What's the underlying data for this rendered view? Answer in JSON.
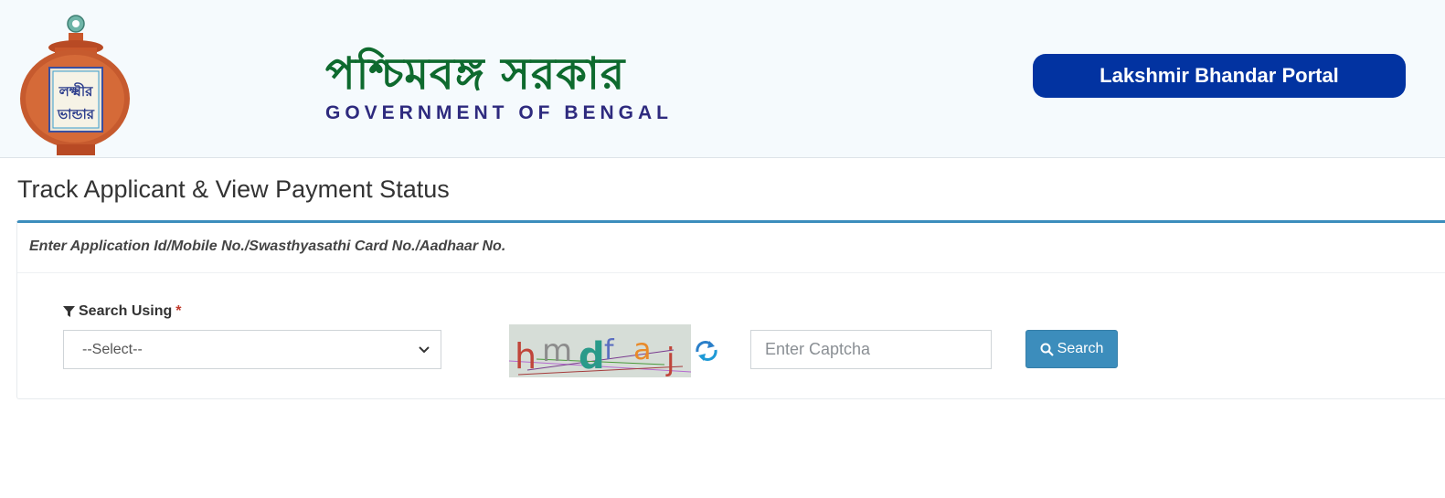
{
  "header": {
    "bengali_title": "পশ্চিমবঙ্গ সরকার",
    "english_title": "GOVERNMENT OF BENGAL",
    "portal_label": "Lakshmir Bhandar Portal",
    "logo_text_line1": "লক্ষ্মীর",
    "logo_text_line2": "ভান্ডার"
  },
  "page": {
    "heading": "Track Applicant & View Payment Status"
  },
  "form": {
    "instruction": "Enter Application Id/Mobile No./Swasthyasathi Card No./Aadhaar No.",
    "search_label": "Search Using",
    "required_mark": "*",
    "select_value": "--Select--",
    "captcha_text": "hmdfaj",
    "captcha_placeholder": "Enter Captcha",
    "search_button": "Search"
  },
  "colors": {
    "brand_green": "#0e6a2e",
    "portal_blue": "#0233a1",
    "accent_blue": "#3c8dbc"
  },
  "icons": [
    "filter-icon",
    "chevron-down-icon",
    "refresh-icon",
    "search-icon"
  ]
}
